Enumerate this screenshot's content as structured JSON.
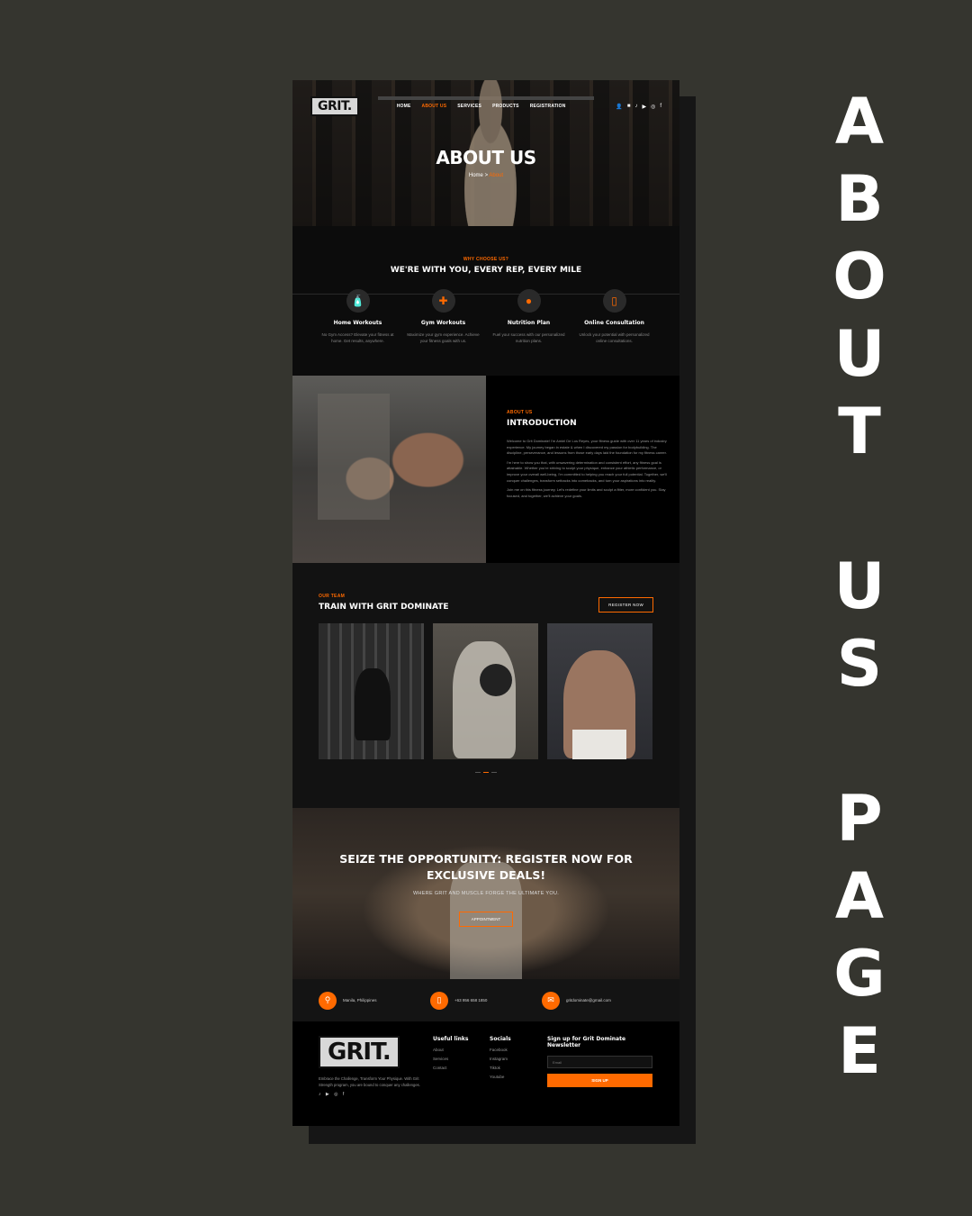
{
  "side_title": {
    "line1": [
      "A",
      "B",
      "O",
      "U",
      "T"
    ],
    "line2": [
      "U",
      "S"
    ],
    "line3": [
      "P",
      "A",
      "G",
      "E"
    ]
  },
  "nav": {
    "logo": "GRIT.",
    "links": [
      "HOME",
      "ABOUT US",
      "SERVICES",
      "PRODUCTS",
      "REGISTRATION"
    ],
    "active_index": 1,
    "icons": [
      "user-icon",
      "cart-icon",
      "tiktok-icon",
      "youtube-icon",
      "instagram-icon",
      "facebook-icon"
    ]
  },
  "hero": {
    "title": "ABOUT US",
    "breadcrumb_home": "Home",
    "breadcrumb_sep": ">",
    "breadcrumb_current": "About"
  },
  "why": {
    "eyebrow": "WHY CHOOSE US?",
    "title": "WE'RE WITH YOU, EVERY REP, EVERY MILE",
    "features": [
      {
        "icon": "bottle-icon",
        "title": "Home Workouts",
        "desc": "No Gym Access? Elevate your fitness at home. Get results, anywhere."
      },
      {
        "icon": "dumbbell-icon",
        "title": "Gym Workouts",
        "desc": "Maximize your gym experience. Achieve your fitness goals with us."
      },
      {
        "icon": "apple-icon",
        "title": "Nutrition Plan",
        "desc": "Fuel your success with our personalized nutrition plans."
      },
      {
        "icon": "phone-icon",
        "title": "Online Consultation",
        "desc": "Unlock your potential with personalized online consultations."
      }
    ]
  },
  "intro": {
    "eyebrow": "ABOUT US",
    "title": "INTRODUCTION",
    "paragraphs": [
      "Welcome to Grit Dominate! I'm Amiel De Los Reyes, your fitness guide with over 11 years of industry experience. My journey began in estate & when I discovered my passion for bodybuilding. The discipline, perseverance, and lessons from those early days laid the foundation for my fitness career.",
      "I'm here to show you that, with unwavering determination and consistent effort, any fitness goal is attainable. Whether you're striving to sculpt your physique, enhance your athletic performance, or improve your overall well-being, I'm committed to helping you reach your full potential. Together, we'll conquer challenges, transform setbacks into comebacks, and turn your aspirations into reality.",
      "Join me on this fitness journey. Let's redefine your limits and sculpt a fitter, more confident you. Stay focused, and together, we'll achieve your goals."
    ]
  },
  "team": {
    "eyebrow": "OUR TEAM",
    "title": "TRAIN WITH GRIT DOMINATE",
    "button": "REGISTER NOW",
    "slides": 3,
    "active_slide": 1
  },
  "cta": {
    "title": "SEIZE THE OPPORTUNITY: REGISTER NOW FOR EXCLUSIVE DEALS!",
    "subtitle": "WHERE GRIT AND MUSCLE FORGE THE ULTIMATE YOU.",
    "button": "APPOINTMENT"
  },
  "contact": {
    "location": "Manila, Philippines",
    "phone": "+63 956 658 1850",
    "email": "gritdominate@gmail.com"
  },
  "footer": {
    "logo": "GRIT.",
    "about": "Embrace the Challenge, Transform Your Physique. With Grit Strength program, you are bound to conquer any challenges.",
    "social_icons": "♪ ▶ ◎ f",
    "useful_title": "Useful links",
    "useful_links": [
      "About",
      "Services",
      "Contact"
    ],
    "socials_title": "Socials",
    "socials": [
      "Facebook",
      "Instagram",
      "Tiktok",
      "Youtube"
    ],
    "newsletter_title": "Sign up for Grit Dominate Newsletter",
    "email_placeholder": "Email",
    "submit": "SIGN UP"
  },
  "colors": {
    "accent": "#ff6a00",
    "page_bg": "#35352f",
    "site_bg": "#0c0c0c"
  }
}
